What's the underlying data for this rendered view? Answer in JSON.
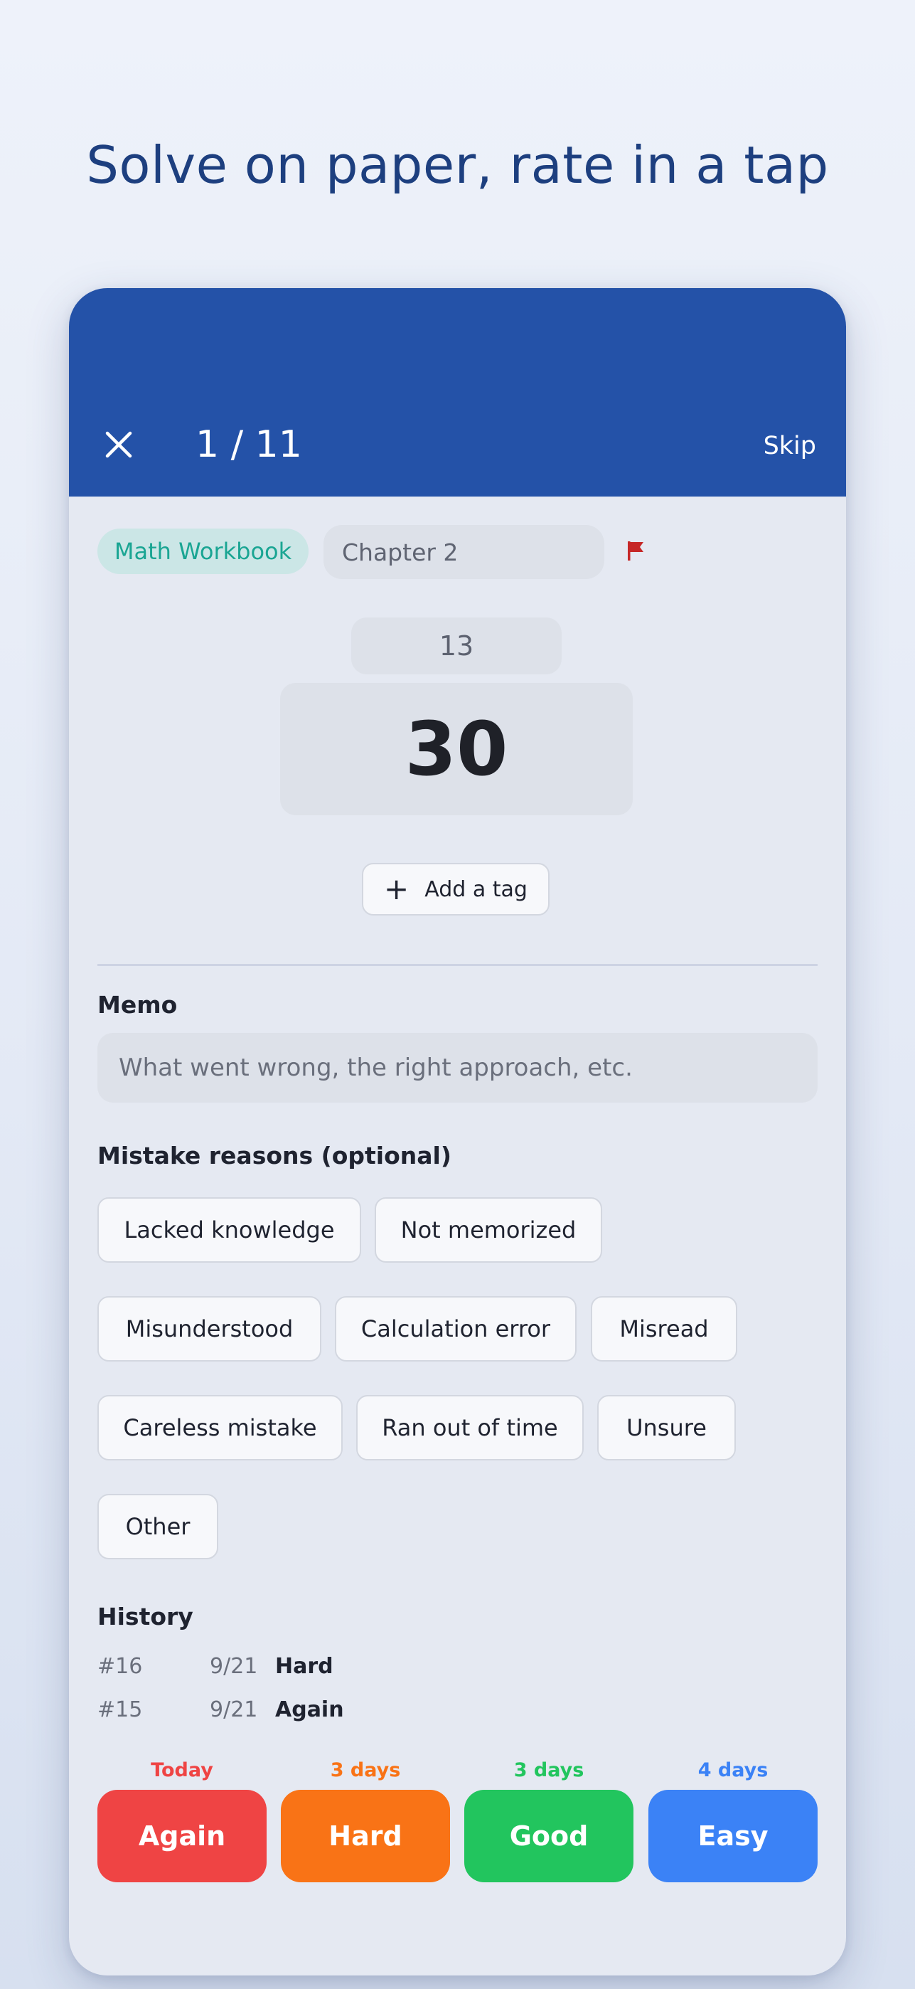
{
  "headline": "Solve on paper, rate in a tap",
  "appbar": {
    "progress": "1 / 11",
    "skip_label": "Skip",
    "background": "#2452a8"
  },
  "card": {
    "deck_name": "Math Workbook",
    "chapter": "Chapter 2",
    "question_number": "13",
    "answer": "30",
    "add_tag_label": "Add a tag"
  },
  "memo": {
    "label": "Memo",
    "placeholder": "What went wrong, the right approach, etc."
  },
  "mistake_reasons": {
    "label": "Mistake reasons (optional)",
    "options": [
      "Lacked knowledge",
      "Not memorized",
      "Misunderstood",
      "Calculation error",
      "Misread",
      "Careless mistake",
      "Ran out of time",
      "Unsure",
      "Other"
    ]
  },
  "history": {
    "label": "History",
    "rows": [
      {
        "num": "#16",
        "date": "9/21",
        "rating": "Hard"
      },
      {
        "num": "#15",
        "date": "9/21",
        "rating": "Again"
      }
    ]
  },
  "ratings": [
    {
      "interval": "Today",
      "label": "Again",
      "color": "#ef4444"
    },
    {
      "interval": "3 days",
      "label": "Hard",
      "color": "#f97316"
    },
    {
      "interval": "3 days",
      "label": "Good",
      "color": "#22c55e"
    },
    {
      "interval": "4 days",
      "label": "Easy",
      "color": "#3b82f6"
    }
  ],
  "icons": {
    "close": "close-icon",
    "flag": "flag-icon",
    "add": "plus-icon"
  }
}
